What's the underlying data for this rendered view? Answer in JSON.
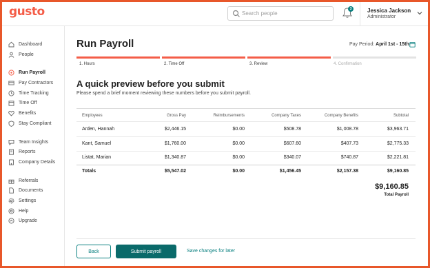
{
  "brand": {
    "logo": "gusto",
    "accent": "#f45d48",
    "primary": "#0a6a6a"
  },
  "header": {
    "search_placeholder": "Search people",
    "notification_count": "3",
    "user_name": "Jessica Jackson",
    "user_role": "Administrator"
  },
  "sidebar": {
    "items": [
      {
        "label": "Dashboard",
        "icon": "home-icon"
      },
      {
        "label": "People",
        "icon": "person-icon"
      },
      {
        "label": "Run Payroll",
        "icon": "payroll-icon",
        "active": true
      },
      {
        "label": "Pay Contractors",
        "icon": "card-icon"
      },
      {
        "label": "Time Tracking",
        "icon": "clock-icon"
      },
      {
        "label": "Time Off",
        "icon": "calendar-icon"
      },
      {
        "label": "Benefits",
        "icon": "heart-icon"
      },
      {
        "label": "Stay Compliant",
        "icon": "shield-icon"
      },
      {
        "label": "Team Insights",
        "icon": "chat-icon"
      },
      {
        "label": "Reports",
        "icon": "report-icon"
      },
      {
        "label": "Company Details",
        "icon": "building-icon"
      },
      {
        "label": "Referrals",
        "icon": "gift-icon"
      },
      {
        "label": "Documents",
        "icon": "document-icon"
      },
      {
        "label": "Settings",
        "icon": "gear-icon"
      },
      {
        "label": "Help",
        "icon": "help-icon"
      },
      {
        "label": "Upgrade",
        "icon": "upgrade-icon"
      }
    ]
  },
  "main": {
    "title": "Run Payroll",
    "pay_period_label": "Pay Period:",
    "pay_period_value": "April 1st - 15th",
    "steps": [
      {
        "label": "1. Hours",
        "state": "done"
      },
      {
        "label": "2. Time Off",
        "state": "done"
      },
      {
        "label": "3. Review",
        "state": "current"
      },
      {
        "label": "4. Confirmation",
        "state": "todo"
      }
    ],
    "heading": "A quick preview before you submit",
    "subtitle": "Please spend a brief moment reviewing these numbers before you submit payroll."
  },
  "table": {
    "headers": [
      "Employees",
      "Gross Pay",
      "Reimbursements",
      "Company Taxes",
      "Company Benefits",
      "Subtotal"
    ],
    "rows": [
      [
        "Arden, Hannah",
        "$2,446.15",
        "$0.00",
        "$508.78",
        "$1,008.78",
        "$3,963.71"
      ],
      [
        "Kant, Samuel",
        "$1,760.00",
        "$0.00",
        "$607.60",
        "$407.73",
        "$2,775.33"
      ],
      [
        "Listat, Marian",
        "$1,340.87",
        "$0.00",
        "$340.07",
        "$740.87",
        "$2,221.81"
      ]
    ],
    "totals": [
      "Totals",
      "$5,547.02",
      "$0.00",
      "$1,456.45",
      "$2,157.38",
      "$9,160.85"
    ]
  },
  "summary": {
    "total": "$9,160.85",
    "label": "Total Payroll"
  },
  "actions": {
    "back": "Back",
    "submit": "Submit payroll",
    "save": "Save changes for later"
  }
}
